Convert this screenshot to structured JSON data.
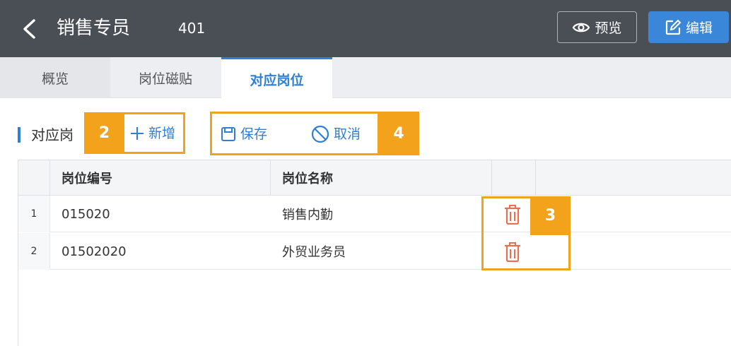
{
  "header": {
    "title": "销售专员",
    "code": "401",
    "preview_label": "预览",
    "edit_label": "编辑",
    "bg_color": "#4a4e55",
    "accent_color": "#3a86d8"
  },
  "tabs": [
    {
      "label": "概览"
    },
    {
      "label": "岗位磁贴"
    },
    {
      "label": "对应岗位",
      "active": true
    }
  ],
  "section": {
    "title": "对应岗"
  },
  "toolbar": {
    "add_label": "新增",
    "save_label": "保存",
    "cancel_label": "取消"
  },
  "annotations": {
    "badge_2": "2",
    "badge_3": "3",
    "badge_4": "4",
    "color": "#f3a21b"
  },
  "table": {
    "columns": [
      "岗位编号",
      "岗位名称"
    ],
    "rows": [
      {
        "index": "1",
        "code": "015020",
        "name": "销售内勤"
      },
      {
        "index": "2",
        "code": "01502020",
        "name": "外贸业务员"
      }
    ]
  }
}
